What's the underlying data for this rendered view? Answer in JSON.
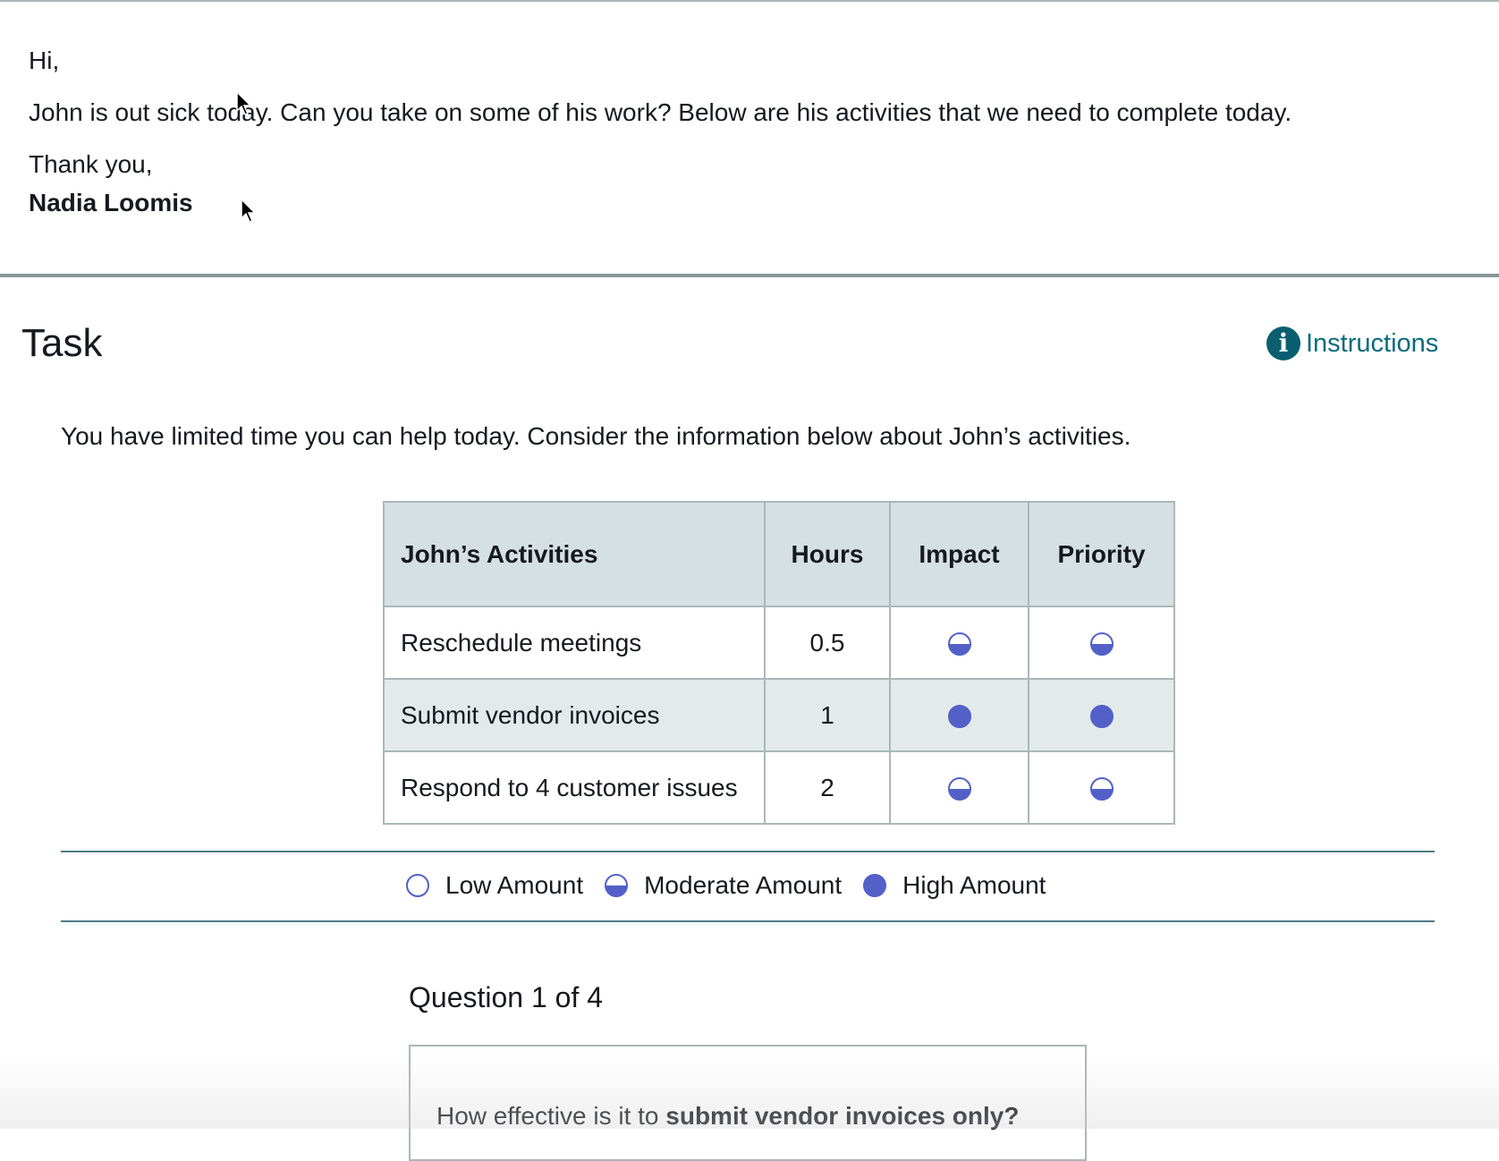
{
  "email": {
    "greeting": "Hi,",
    "body": "John is out sick today. Can you take on some of his work? Below are his activities that we need to complete today.",
    "closing": "Thank you,",
    "sender": "Nadia Loomis"
  },
  "task": {
    "title": "Task",
    "instructions_label": "Instructions",
    "intro": "You have limited time you can help today. Consider the information below about John’s activities."
  },
  "table": {
    "headers": {
      "activity": "John’s Activities",
      "hours": "Hours",
      "impact": "Impact",
      "priority": "Priority"
    },
    "rows": [
      {
        "activity": "Reschedule meetings",
        "hours": "0.5",
        "impact": "moderate",
        "priority": "moderate"
      },
      {
        "activity": "Submit vendor invoices",
        "hours": "1",
        "impact": "high",
        "priority": "high"
      },
      {
        "activity": "Respond to 4 customer issues",
        "hours": "2",
        "impact": "moderate",
        "priority": "moderate"
      }
    ]
  },
  "legend": {
    "low": "Low Amount",
    "moderate": "Moderate Amount",
    "high": "High Amount"
  },
  "question": {
    "counter": "Question 1 of 4",
    "prompt_prefix": "How effective is it to ",
    "prompt_bold": "submit vendor invoices only?"
  },
  "colors": {
    "accent_dot": "#5260c8",
    "link": "#0a6a7a",
    "header_bg": "#d5e0e3"
  }
}
